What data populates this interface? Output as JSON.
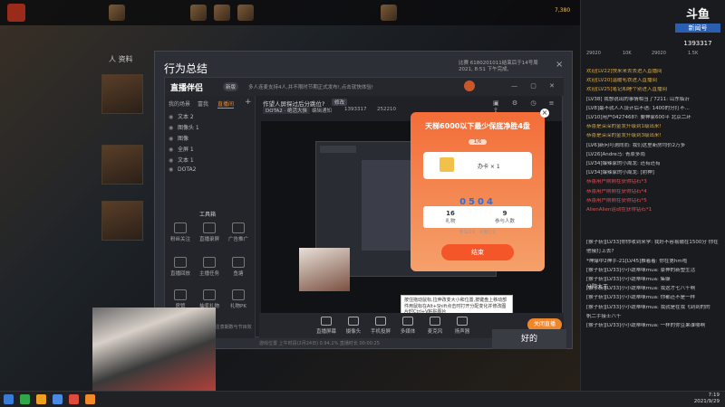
{
  "window": {
    "title": "行为总结",
    "notice": "比赛 6180201011结束后于14号周 2021, 8:51 下午完成,",
    "ok_label": "好的"
  },
  "game": {
    "left_label": "人 资料",
    "top_hp": "7,380"
  },
  "app": {
    "logo": "直播伴侣",
    "badge": "新版",
    "tip": "多人连麦支持4人,并不限时节期正式发布!,点击就快体验!",
    "sidebar_tabs": [
      "我的场景",
      "富我",
      "直播间"
    ],
    "scenes": [
      "文本 2",
      "图像头 1",
      "图像",
      "全屏 1",
      "文本 1",
      "DOTA2"
    ],
    "tools_title": "工具箱",
    "tools": [
      "粉丝关注",
      "直播录屏",
      "广告推广",
      "直播回放",
      "主播任务",
      "鱼塘",
      "房管",
      "抽奖礼物",
      "礼物PK"
    ],
    "sidebar_foot": "当前房间开播后播放,请注意期数与节目效果",
    "room_title": "作望人屏探过后分跳位?",
    "room_edit": "修改",
    "room_category": "DOTA2 · 绝活大侠",
    "room_meta": [
      "编辑通知",
      "1393317",
      "252210"
    ],
    "bottom_buttons": [
      "直播屏幕",
      "摄像头",
      "手机投屏",
      "多媒体",
      "麦克风",
      "扬声器"
    ],
    "start_live": "关闭直播",
    "status": "游戏位置 上午时段(2月24日) 0.94,1%  直播时长 00:00:25",
    "tooltip": "按住拖动鼠标,拉伸改变大小和位置,按键盘上移动部件用鼠标在Alt+Shift点击时打开分配变化并修改图片时Ctrl+V粘贴图片"
  },
  "prize": {
    "title": "天梯6000以下最少保底净胜4盘",
    "subtitle": "1/6",
    "item_name": "办卡 × 1",
    "countdown": "0504",
    "stat1_value": "16",
    "stat1_label": "礼物",
    "stat2_value": "9",
    "stat2_label": "参与人数",
    "input_hint": "参与口令 · 礼物口令",
    "end_label": "结束",
    "close": "×"
  },
  "chat": {
    "brand": "斗鱼",
    "brand_sub": "新闻号",
    "room_id": "1393317",
    "badges": [
      "29020",
      "10K",
      "29020",
      "1.5K"
    ],
    "lines": [
      {
        "text": "欢迎[LV22]快来来去去进入直播间",
        "kind": "sys"
      },
      {
        "text": "欢迎[LV20]温暖毛衣进入直播间",
        "kind": "sys"
      },
      {
        "text": "欢迎[LV25]笔记和睡个别进入直播间",
        "kind": "sys"
      },
      {
        "text": "[LV38] 我想说出的事情相当了7211: 山东临沂",
        "kind": "normal"
      },
      {
        "text": "[LV8]最不就人人设计后不语: 1400的分打不...",
        "kind": "normal"
      },
      {
        "text": "[LV10]用户0427468?: 要神家600平 北京二环",
        "kind": "normal"
      },
      {
        "text": "恭喜是深深的金发升级到1级出来!",
        "kind": "sys"
      },
      {
        "text": "恭喜是深深的金发升级到3级出来!",
        "kind": "sys"
      },
      {
        "text": "[LV6]新问可测向而: 我们这里新房均价2万多",
        "kind": "normal"
      },
      {
        "text": "[LV26]Andre马: 青原多雨",
        "kind": "normal"
      },
      {
        "text": "[LV34]爆辣家的小周龙: 还有还有",
        "kind": "normal"
      },
      {
        "text": "[LV34]爆辣家的小周龙: [射神]",
        "kind": "normal"
      },
      {
        "text": "恭喜用户刚刚在获得钻石*3",
        "kind": "gift"
      },
      {
        "text": "恭喜用户刚刚在获得钻石*4",
        "kind": "gift"
      },
      {
        "text": "恭喜用户刚刚在获得钻石*5",
        "kind": "gift"
      },
      {
        "text": "AlienAlien运动在获得钻石*1",
        "kind": "gift"
      },
      {
        "text": "[猴子斩][LV33]你你收到来学: 我好不容易输在1500分 你在",
        "kind": "normal"
      },
      {
        "text": "他俄打上去?",
        "kind": "normal"
      },
      {
        "text": "*神爆中2神手-21[LV45]推着着: 你在第hm啦",
        "kind": "normal"
      },
      {
        "text": "[猴子斩][LV33]小小蔬蒂咪mua: 豪神的新塑生活",
        "kind": "normal"
      },
      {
        "text": "[猴子斩][LV33]小小蔬蒂咪mua: 集躲",
        "kind": "normal"
      },
      {
        "text": "[猴子斩][LV33]小小蔬蒂咪mua: 我这才七八千啊",
        "kind": "normal"
      },
      {
        "text": "[猴子斩][LV33]小小蔬蒂咪mua: 你都还不是一样",
        "kind": "normal"
      },
      {
        "text": "[猴子斩][LV33]小小蔬蒂咪mua: 我就是在我飞到到的的",
        "kind": "normal"
      },
      {
        "text": "帆二手接士八千",
        "kind": "normal"
      },
      {
        "text": "[猴子斩][LV33]小小蔬蒂咪mua: 一样的你豆果谁哪啊",
        "kind": "normal"
      }
    ],
    "team_label": "分院大王"
  },
  "taskbar": {
    "time": "7:19",
    "date": "2021/9/29"
  }
}
